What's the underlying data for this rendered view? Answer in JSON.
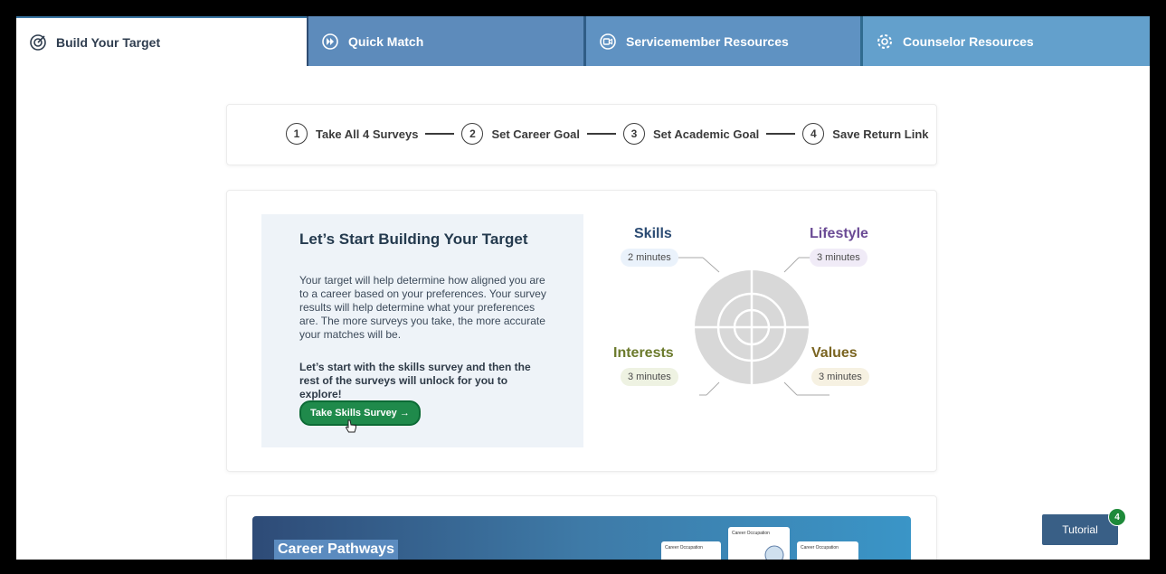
{
  "tabs": [
    {
      "label": "Build Your Target",
      "icon": "target-icon"
    },
    {
      "label": "Quick Match",
      "icon": "fast-forward-icon"
    },
    {
      "label": "Servicemember Resources",
      "icon": "video-icon"
    },
    {
      "label": "Counselor Resources",
      "icon": "gear-icon"
    }
  ],
  "stepper": {
    "steps": [
      {
        "num": "1",
        "label": "Take All 4 Surveys"
      },
      {
        "num": "2",
        "label": "Set Career Goal"
      },
      {
        "num": "3",
        "label": "Set Academic Goal"
      },
      {
        "num": "4",
        "label": "Save Return Link"
      }
    ]
  },
  "intro": {
    "title": "Let’s Start Building Your Target",
    "paragraph1": "Your target will help determine how aligned you are to a career based on your preferences. Your survey results will help determine what your preferences are. The more surveys you take, the more accurate your matches will be.",
    "paragraph2": "Let’s start with the skills survey and then the rest of the surveys will unlock for you to explore!",
    "button_label": "Take Skills Survey →"
  },
  "target": {
    "skills": {
      "label": "Skills",
      "time": "2 minutes",
      "color": "#2b4b73",
      "pill_bg": "#eaf2fb"
    },
    "lifestyle": {
      "label": "Lifestyle",
      "time": "3 minutes",
      "color": "#6b4b95",
      "pill_bg": "#f0ebf7"
    },
    "interests": {
      "label": "Interests",
      "time": "3 minutes",
      "color": "#6b7a2c",
      "pill_bg": "#eef2e2"
    },
    "values": {
      "label": "Values",
      "time": "3 minutes",
      "color": "#7a6420",
      "pill_bg": "#f6f1e2"
    }
  },
  "pathways": {
    "title": "Career Pathways",
    "cards": [
      "Career Occupation",
      "Career Occupation",
      "Career Occupation"
    ]
  },
  "tutorial": {
    "label": "Tutorial",
    "badge": "4"
  }
}
